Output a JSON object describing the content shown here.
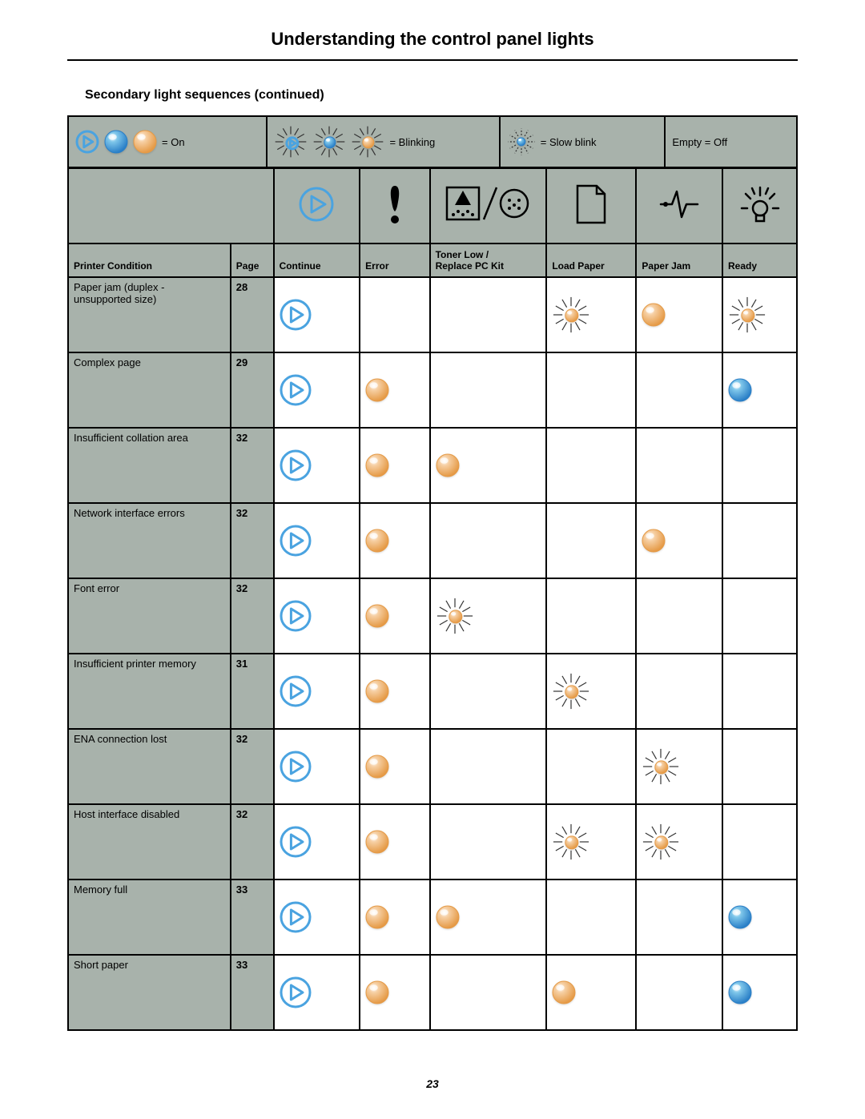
{
  "title": "Understanding the control panel lights",
  "subtitle": "Secondary light sequences (continued)",
  "page_number": "23",
  "legend": {
    "on": "= On",
    "blinking": "= Blinking",
    "slow_blink": "= Slow blink",
    "off": "Empty = Off"
  },
  "columns": {
    "printer_condition": "Printer Condition",
    "page": "Page",
    "continue": "Continue",
    "error": "Error",
    "toner": "Toner Low /\nReplace PC Kit",
    "load_paper": "Load Paper",
    "paper_jam": "Paper Jam",
    "ready": "Ready"
  },
  "rows": [
    {
      "condition": "Paper jam (duplex - unsupported size)",
      "page": "28",
      "lights": [
        "on-continue",
        "",
        "",
        "blink-orange",
        "on-orange",
        "blink-orange"
      ]
    },
    {
      "condition": "Complex page",
      "page": "29",
      "lights": [
        "on-continue",
        "on-orange",
        "",
        "",
        "",
        "on-blue"
      ]
    },
    {
      "condition": "Insufficient collation area",
      "page": "32",
      "lights": [
        "on-continue",
        "on-orange",
        "on-orange",
        "",
        "",
        ""
      ]
    },
    {
      "condition": "Network interface errors",
      "page": "32",
      "lights": [
        "on-continue",
        "on-orange",
        "",
        "",
        "on-orange",
        ""
      ]
    },
    {
      "condition": "Font error",
      "page": "32",
      "lights": [
        "on-continue",
        "on-orange",
        "blink-orange",
        "",
        "",
        ""
      ]
    },
    {
      "condition": "Insufficient printer memory",
      "page": "31",
      "lights": [
        "on-continue",
        "on-orange",
        "",
        "blink-orange",
        "",
        ""
      ]
    },
    {
      "condition": "ENA connection lost",
      "page": "32",
      "lights": [
        "on-continue",
        "on-orange",
        "",
        "",
        "blink-orange",
        ""
      ]
    },
    {
      "condition": "Host interface disabled",
      "page": "32",
      "lights": [
        "on-continue",
        "on-orange",
        "",
        "blink-orange",
        "blink-orange",
        ""
      ]
    },
    {
      "condition": "Memory full",
      "page": "33",
      "lights": [
        "on-continue",
        "on-orange",
        "on-orange",
        "",
        "",
        "on-blue"
      ]
    },
    {
      "condition": "Short paper",
      "page": "33",
      "lights": [
        "on-continue",
        "on-orange",
        "",
        "on-orange",
        "",
        "on-blue"
      ]
    }
  ],
  "colors": {
    "blue_light": "#7ec6ea",
    "blue_dark": "#2a7fc7",
    "orange_light": "#f6cfa3",
    "orange_dark": "#e59a46",
    "continue_stroke": "#4aa3e0"
  }
}
